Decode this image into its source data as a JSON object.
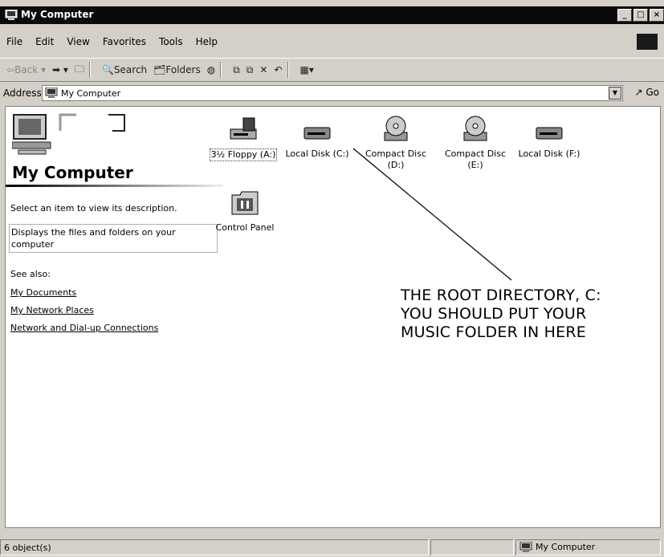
{
  "window": {
    "title": "My Computer",
    "controls": [
      "_",
      "□",
      "×"
    ]
  },
  "menu": [
    "File",
    "Edit",
    "View",
    "Favorites",
    "Tools",
    "Help"
  ],
  "toolbar": {
    "back": "Back",
    "search": "Search",
    "folders": "Folders"
  },
  "address": {
    "label": "Address",
    "value": "My Computer",
    "go": "Go"
  },
  "left": {
    "heading": "My Computer",
    "prompt": "Select an item to view its description.",
    "description": "Displays the files and folders on your computer",
    "see_also": "See also:",
    "links": [
      "My Documents",
      "My Network Places",
      "Network and Dial-up Connections"
    ]
  },
  "items": [
    {
      "name": "3½ Floppy (A:)",
      "icon": "floppy-drive-icon"
    },
    {
      "name": "Local Disk (C:)",
      "icon": "hard-disk-icon"
    },
    {
      "name": "Compact Disc (D:)",
      "icon": "cd-drive-icon"
    },
    {
      "name": "Compact Disc (E:)",
      "icon": "cd-drive-icon"
    },
    {
      "name": "Local Disk (F:)",
      "icon": "hard-disk-icon"
    },
    {
      "name": "Control Panel",
      "icon": "control-panel-icon"
    }
  ],
  "annotation": [
    "THE ROOT DIRECTORY, C:",
    "YOU SHOULD PUT YOUR",
    "MUSIC FOLDER IN HERE"
  ],
  "status": {
    "count": "6 object(s)",
    "zone": "My Computer"
  }
}
